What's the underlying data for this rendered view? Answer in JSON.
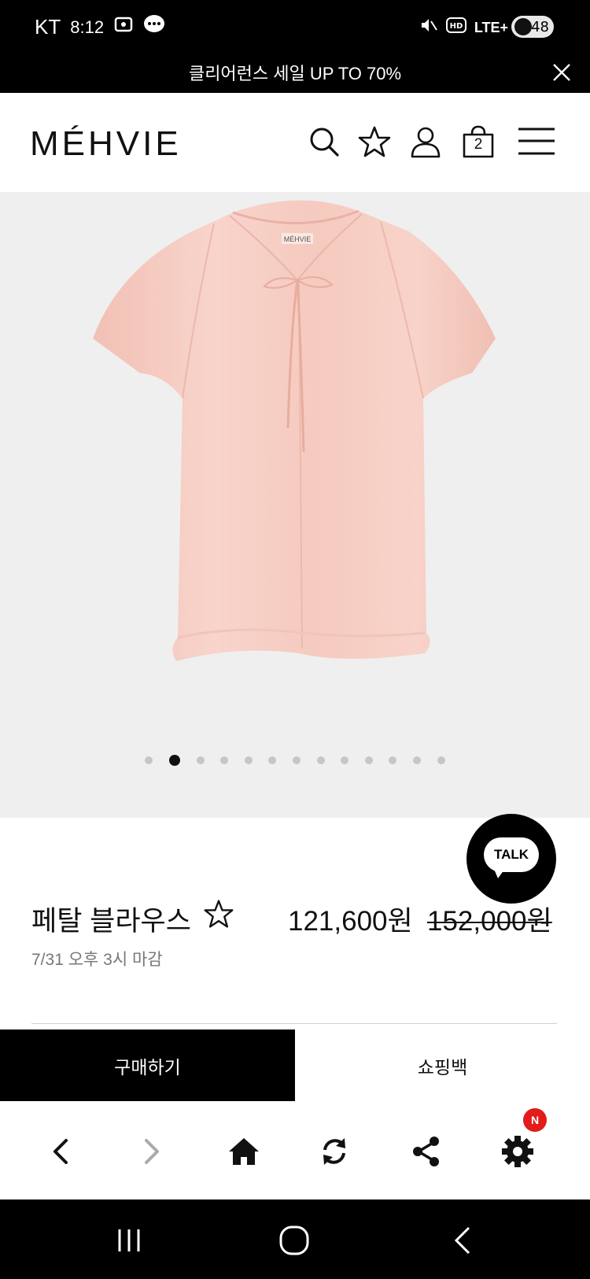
{
  "status_bar": {
    "carrier": "KT",
    "time": "8:12",
    "network": "LTE+",
    "battery": "48",
    "colors": {
      "background": "#000000",
      "text": "#ffffff"
    }
  },
  "promo_banner": {
    "text": "클리어런스 세일 UP TO 70%"
  },
  "header": {
    "logo": "MÉHVIE",
    "bag_count": "2",
    "icons": [
      "search-icon",
      "star-icon",
      "user-icon",
      "bag-icon",
      "menu-icon"
    ]
  },
  "gallery": {
    "image_label": "MÉHVIE",
    "slide_count": 13,
    "active_slide": 2,
    "colors": {
      "background": "#efefef",
      "garment": "#f5c9bf"
    }
  },
  "talk_button": {
    "label": "TALK"
  },
  "product": {
    "name": "페탈 블라우스",
    "sale_price": "121,600원",
    "original_price": "152,000원",
    "deadline": "7/31 오후 3시 마감"
  },
  "actions": {
    "buy_label": "구매하기",
    "bag_label": "쇼핑백"
  },
  "toolbar": {
    "icons": [
      "back-icon",
      "forward-icon",
      "home-icon",
      "refresh-icon",
      "share-icon",
      "settings-icon"
    ],
    "badge": "N",
    "colors": {
      "badge": "#e21b1b"
    }
  },
  "nav_bar": {
    "icons": [
      "recent-apps-icon",
      "home-circle-icon",
      "nav-back-icon"
    ]
  }
}
